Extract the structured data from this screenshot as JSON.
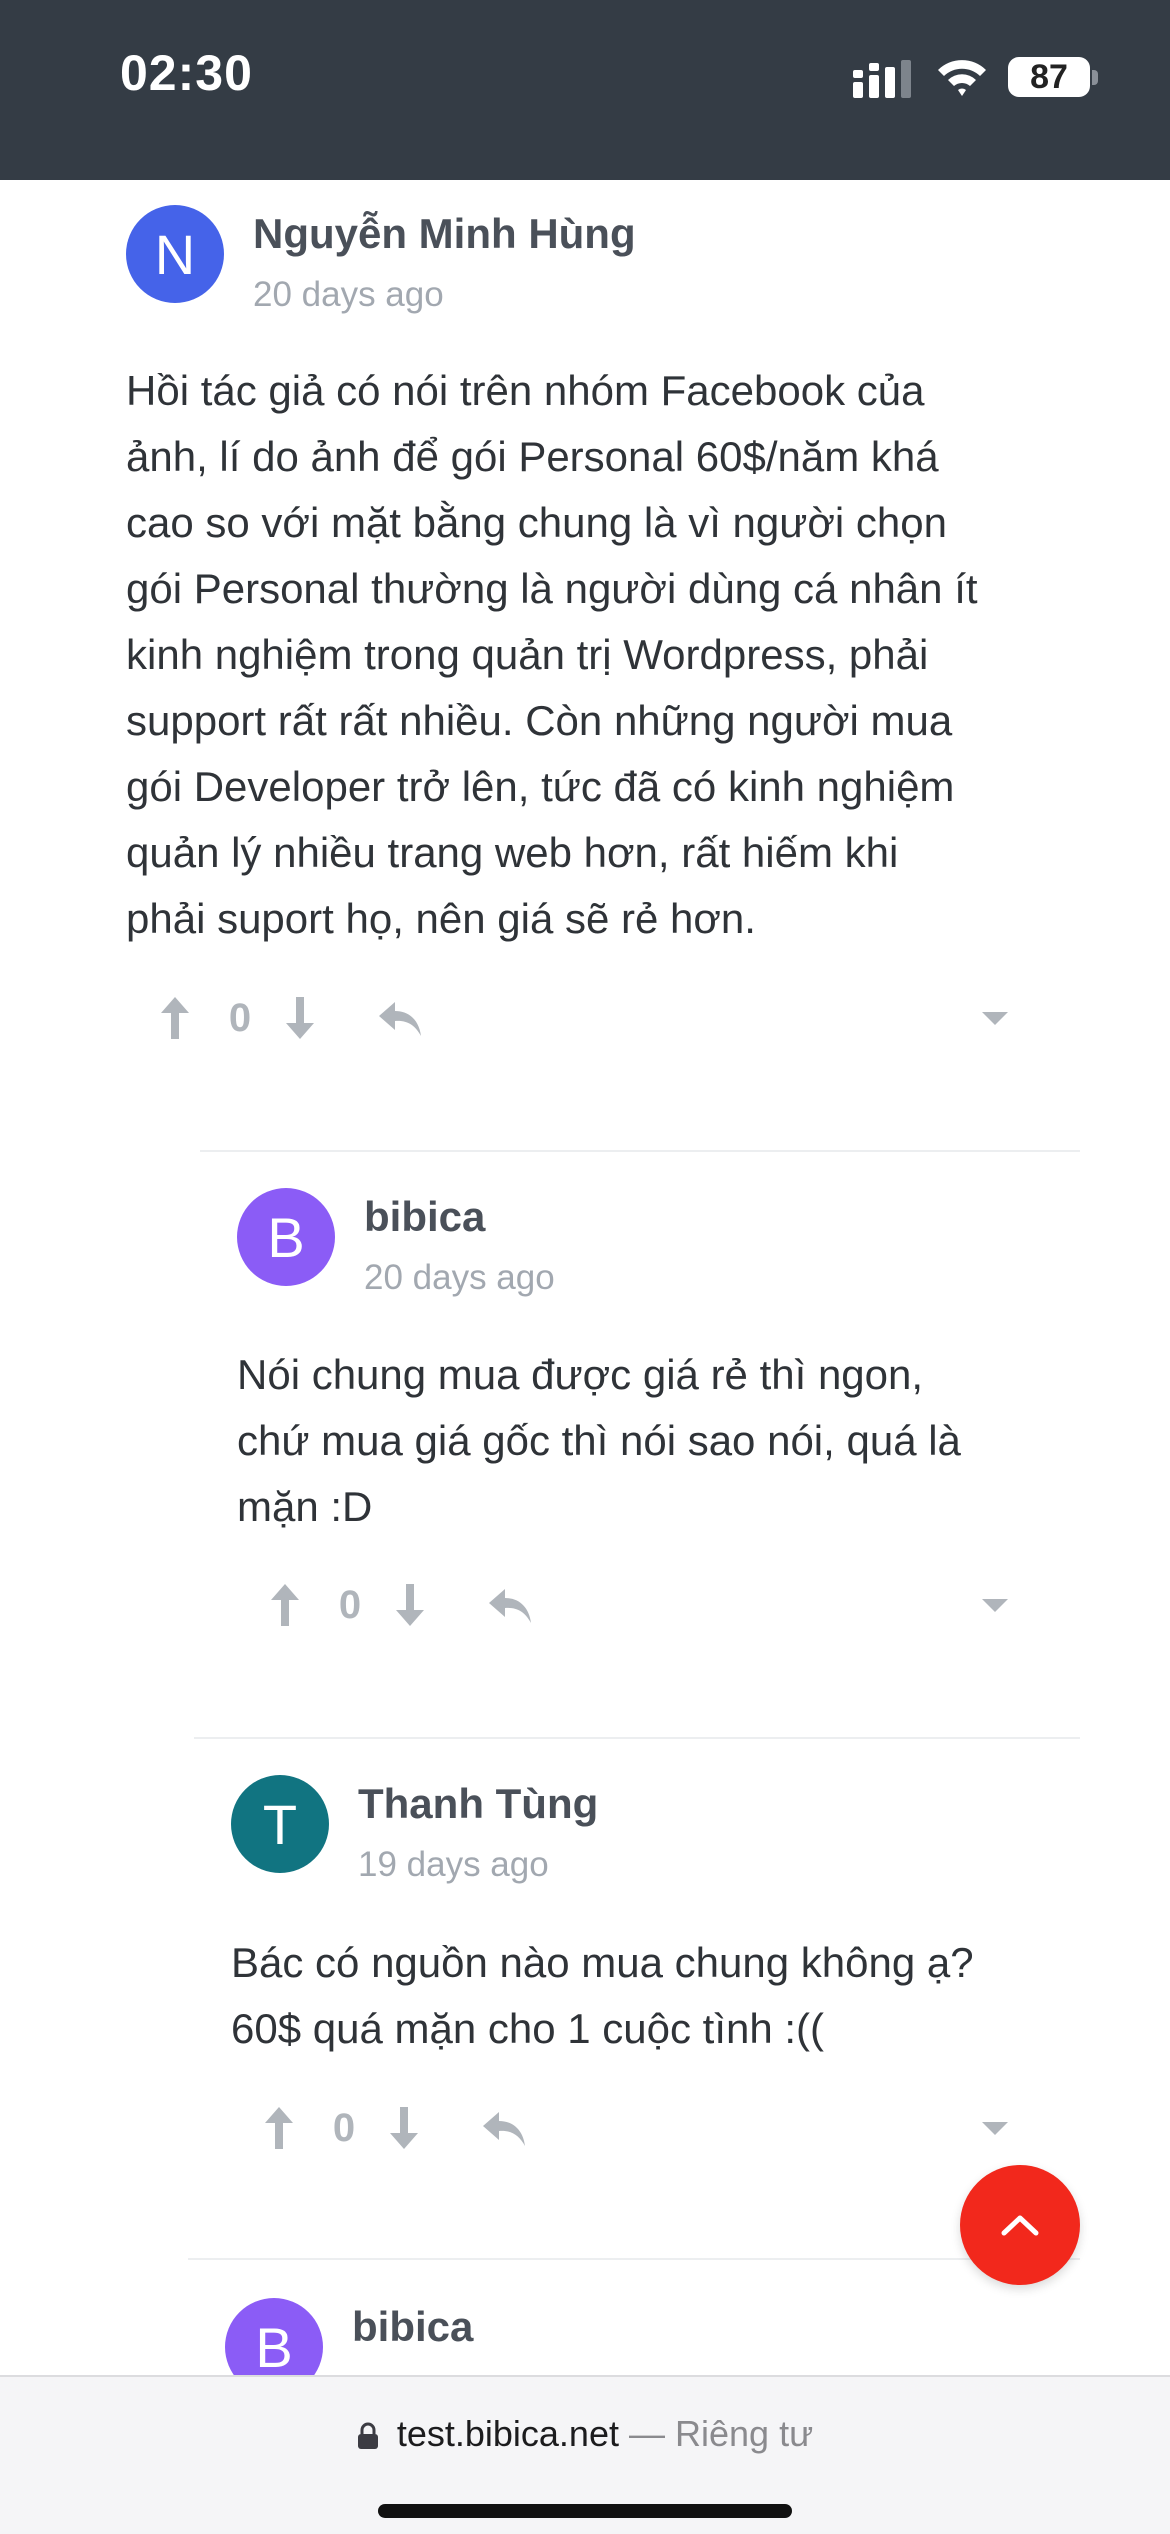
{
  "status_bar": {
    "time": "02:30",
    "battery": "87",
    "icons": [
      "signal-icon",
      "wifi-icon",
      "battery-icon"
    ]
  },
  "comments": [
    {
      "avatar_letter": "N",
      "avatar_color": "#4563e9",
      "author": "Nguyễn Minh Hùng",
      "time": "20 days ago",
      "lines": [
        "Hồi tác giả có nói trên nhóm Facebook của",
        "ảnh, lí do ảnh để gói Personal 60$/năm khá",
        "cao so với mặt bằng chung là vì người chọn",
        "gói Personal thường là người dùng cá nhân ít",
        "kinh nghiệm trong quản trị Wordpress, phải",
        "support rất rất nhiều. Còn những người mua",
        "gói Developer trở lên, tức đã có kinh nghiệm",
        "quản lý nhiều trang web hơn, rất hiếm khi",
        "phải suport họ, nên giá sẽ rẻ hơn."
      ],
      "votes": "0"
    },
    {
      "avatar_letter": "B",
      "avatar_color": "#8b5cf6",
      "author": "bibica",
      "time": "20 days ago",
      "lines": [
        "Nói chung mua được giá rẻ thì ngon,",
        "chứ mua giá gốc thì nói sao nói, quá là",
        "mặn :D"
      ],
      "votes": "0"
    },
    {
      "avatar_letter": "T",
      "avatar_color": "#117481",
      "author": "Thanh Tùng",
      "time": "19 days ago",
      "lines": [
        "Bác có nguồn nào mua chung không ạ?",
        "60$ quá mặn cho 1 cuộc tình :(("
      ],
      "votes": "0"
    },
    {
      "avatar_letter": "B",
      "avatar_color": "#8b5cf6",
      "author": "bibica"
    }
  ],
  "browser": {
    "url": "test.bibica.net",
    "separator": "—",
    "privacy": "Riêng tư"
  },
  "colors": {
    "status_bar_bg": "#343c45",
    "scroll_top_button": "#f2281c",
    "action_icon": "#b0b5bb"
  }
}
